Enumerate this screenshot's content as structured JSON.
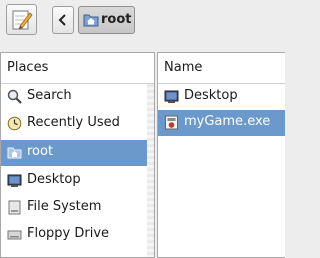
{
  "toolbar": {
    "edit_icon": "pencil-notepad-icon",
    "back_icon": "chevron-left-icon",
    "path_label": "root",
    "path_icon": "home-folder-icon"
  },
  "places": {
    "header": "Places",
    "items": [
      {
        "label": "Search",
        "icon": "magnifier-icon"
      },
      {
        "label": "Recently Used",
        "icon": "clock-icon"
      },
      {
        "label": "root",
        "icon": "home-folder-icon",
        "selected": true
      },
      {
        "label": "Desktop",
        "icon": "desktop-icon"
      },
      {
        "label": "File System",
        "icon": "drive-icon"
      },
      {
        "label": "Floppy Drive",
        "icon": "floppy-icon"
      }
    ]
  },
  "files": {
    "header": "Name",
    "items": [
      {
        "label": "Desktop",
        "icon": "desktop-icon"
      },
      {
        "label": "myGame.exe",
        "icon": "executable-icon",
        "selected": true
      }
    ]
  },
  "colors": {
    "selection": "#6c99cb",
    "window_bg": "#ededed"
  }
}
